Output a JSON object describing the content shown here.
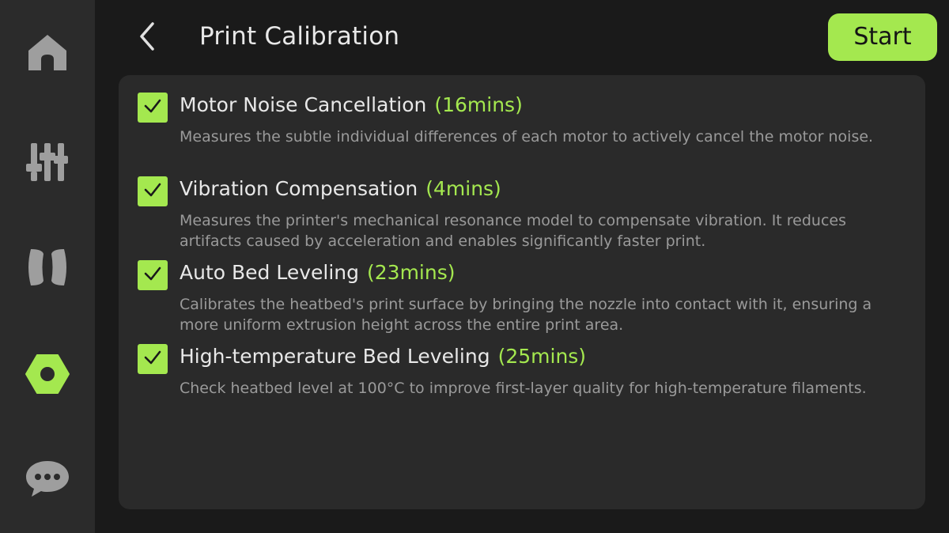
{
  "header": {
    "title": "Print Calibration",
    "start_label": "Start"
  },
  "sidebar": {
    "items": [
      {
        "icon": "home-icon",
        "active": false
      },
      {
        "icon": "controls-icon",
        "active": false
      },
      {
        "icon": "filament-icon",
        "active": false
      },
      {
        "icon": "settings-nut-icon",
        "active": true
      },
      {
        "icon": "chat-icon",
        "active": false
      }
    ]
  },
  "calibration": {
    "items": [
      {
        "checked": true,
        "title": "Motor Noise Cancellation",
        "duration": "(16mins)",
        "description": "Measures the subtle individual differences of each motor to actively cancel the motor noise."
      },
      {
        "checked": true,
        "title": "Vibration Compensation",
        "duration": "(4mins)",
        "description": "Measures the printer's mechanical resonance model to compensate vibration. It reduces artifacts caused by acceleration and enables significantly faster print."
      },
      {
        "checked": true,
        "title": "Auto Bed Leveling",
        "duration": "(23mins)",
        "description": "Calibrates the heatbed's print surface by bringing the nozzle into contact with it, ensuring a more uniform extrusion height across the entire print area."
      },
      {
        "checked": true,
        "title": "High-temperature Bed Leveling",
        "duration": "(25mins)",
        "description": "Check heatbed level at 100°C to improve first-layer quality for high-temperature filaments."
      }
    ]
  },
  "colors": {
    "accent": "#a4e84f",
    "icon_inactive": "#9e9e9e",
    "sidebar_bg": "#2b2b2b",
    "panel_bg": "#2a2a2a"
  }
}
